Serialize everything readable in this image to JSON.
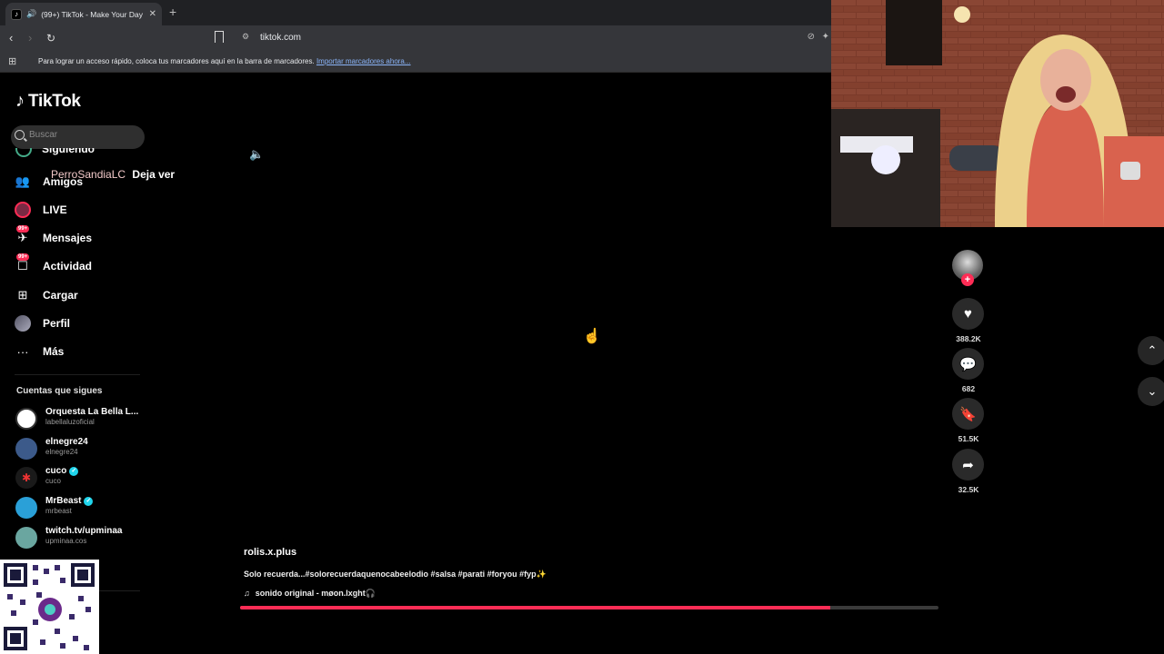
{
  "browser": {
    "tab_title": "(99+) TikTok - Make Your Day",
    "url": "tiktok.com",
    "bookmarks_message": "Para lograr un acceso rápido, coloca tus marcadores aquí en la barra de marcadores.",
    "bookmarks_link": "Importar marcadores ahora..."
  },
  "sidebar": {
    "logo": "TikTok",
    "search_placeholder": "Buscar",
    "cut_item": "Siguiendo",
    "items": [
      {
        "label": "Amigos",
        "icon": "friends-icon"
      },
      {
        "label": "LIVE",
        "icon": "live-icon"
      },
      {
        "label": "Mensajes",
        "icon": "messages-icon",
        "badge": "99+"
      },
      {
        "label": "Actividad",
        "icon": "activity-icon",
        "badge": "99+"
      },
      {
        "label": "Cargar",
        "icon": "upload-icon"
      },
      {
        "label": "Perfil",
        "icon": "profile-icon"
      },
      {
        "label": "Más",
        "icon": "more-icon"
      }
    ],
    "following_title": "Cuentas que sigues",
    "following": [
      {
        "name": "Orquesta La Bella L...",
        "handle": "labellaluzoficial",
        "verified": false,
        "color": "#ffffff"
      },
      {
        "name": "elnegre24",
        "handle": "elnegre24",
        "verified": false,
        "color": "#3c5a8a"
      },
      {
        "name": "cuco",
        "handle": "cuco",
        "verified": true,
        "color": "#1a1a1a"
      },
      {
        "name": "MrBeast",
        "handle": "mrbeast",
        "verified": true,
        "color": "#2aa0d8"
      },
      {
        "name": "twitch.tv/upminaa",
        "handle": "upminaa.cos",
        "verified": false,
        "color": "#6aa6a0"
      }
    ]
  },
  "chat_overlay": {
    "user": "PerroSandiaLC",
    "message": "Deja ver"
  },
  "video": {
    "author": "rolis.x.plus",
    "caption": "Solo recuerda...#solorecuerdaquenocabeelodio #salsa #parati #foryou #fyp✨",
    "sound": "sonido original - møon.lxght🎧",
    "progress": 0.845
  },
  "actions": {
    "likes": "388.2K",
    "comments": "682",
    "saves": "51.5K",
    "shares": "32.5K"
  },
  "colors": {
    "accent": "#fe2c55",
    "verified": "#20d5ec",
    "background": "#000000"
  }
}
